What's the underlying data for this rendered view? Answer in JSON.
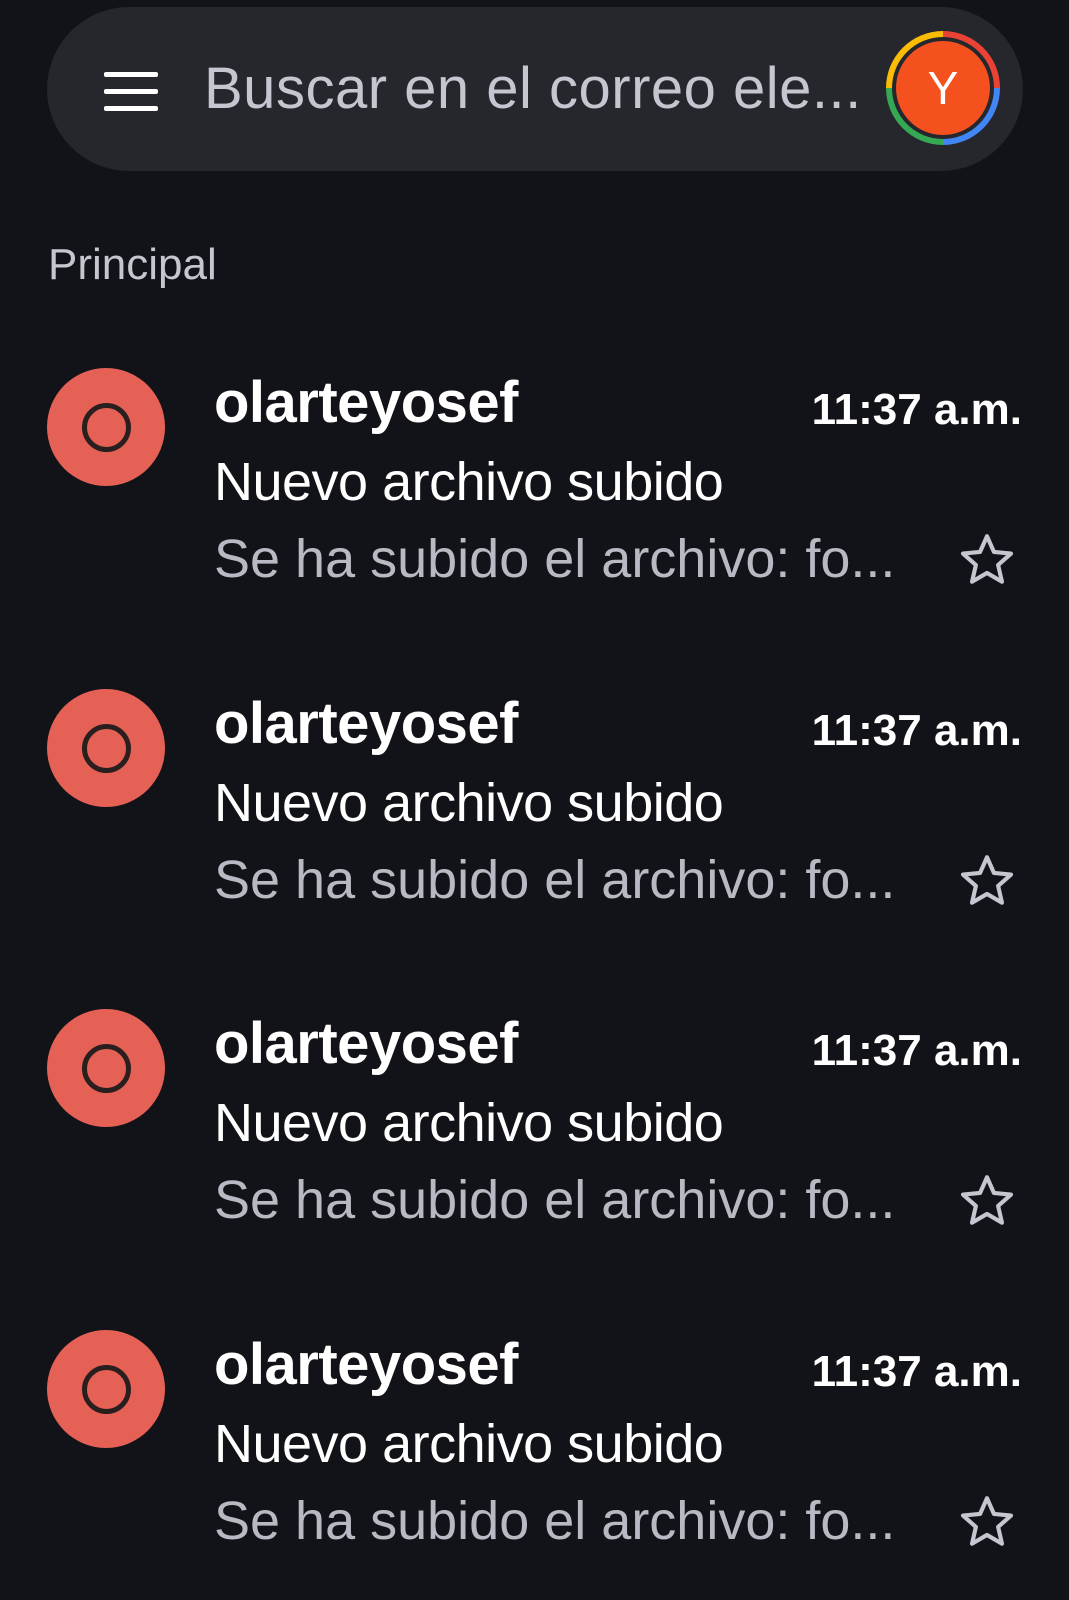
{
  "search": {
    "placeholder": "Buscar en el correo ele...",
    "menu_icon": "hamburger-menu-icon",
    "avatar_letter": "Y",
    "avatar_color": "#f4511e"
  },
  "section": {
    "label": "Principal"
  },
  "emails": [
    {
      "sender": "olarteyosef",
      "time": "11:37 a.m.",
      "subject": "Nuevo archivo subido",
      "snippet": "Se ha subido el archivo: fo...",
      "avatar_icon": "circle-icon",
      "avatar_color": "#e66155",
      "star_icon": "star-outline-icon"
    },
    {
      "sender": "olarteyosef",
      "time": "11:37 a.m.",
      "subject": "Nuevo archivo subido",
      "snippet": "Se ha subido el archivo: fo...",
      "avatar_icon": "circle-icon",
      "avatar_color": "#e66155",
      "star_icon": "star-outline-icon"
    },
    {
      "sender": "olarteyosef",
      "time": "11:37 a.m.",
      "subject": "Nuevo archivo subido",
      "snippet": "Se ha subido el archivo: fo...",
      "avatar_icon": "circle-icon",
      "avatar_color": "#e66155",
      "star_icon": "star-outline-icon"
    },
    {
      "sender": "olarteyosef",
      "time": "11:37 a.m.",
      "subject": "Nuevo archivo subido",
      "snippet": "Se ha subido el archivo: fo...",
      "avatar_icon": "circle-icon",
      "avatar_color": "#e66155",
      "star_icon": "star-outline-icon"
    }
  ]
}
